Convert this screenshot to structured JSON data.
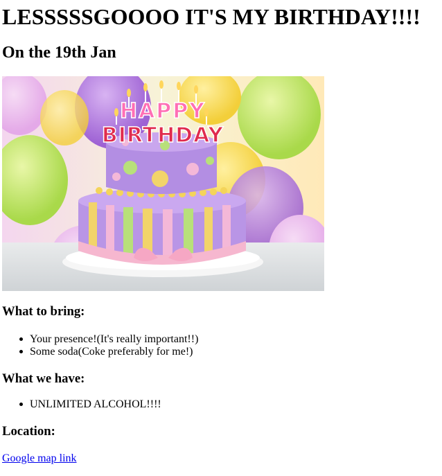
{
  "heading": "LESSSSSGOOOO IT'S MY BIRTHDAY!!!!",
  "subheading": "On the 19th Jan",
  "hero_image": {
    "sign_top": "HAPPY",
    "sign_bottom": "BIRTHDAY"
  },
  "bring": {
    "title": "What to bring:",
    "items": [
      "Your presence!(It's really important!!)",
      "Some soda(Coke preferably for me!)"
    ]
  },
  "have": {
    "title": "What we have:",
    "items": [
      "UNLIMITED ALCOHOL!!!!"
    ]
  },
  "location": {
    "title": "Location:",
    "link_text": "Google map link"
  },
  "colors": {
    "link": "#0000ee",
    "text": "#000000"
  }
}
